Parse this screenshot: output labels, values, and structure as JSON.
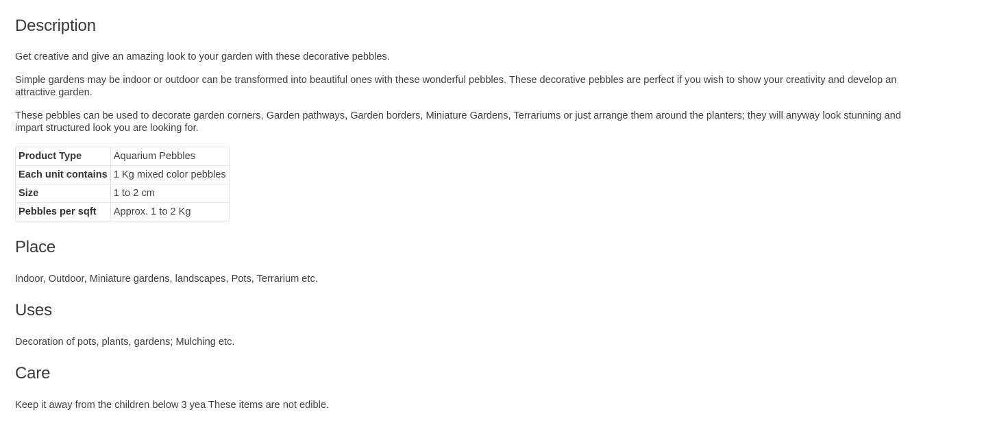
{
  "description": {
    "heading": "Description",
    "paragraphs": [
      "Get creative and give an amazing look to your garden with these decorative pebbles.",
      "Simple gardens may be indoor or outdoor can be transformed into beautiful ones with these wonderful pebbles. These decorative pebbles are perfect if you wish to show your creativity and develop an attractive garden.",
      "These pebbles can be used to decorate garden corners, Garden pathways, Garden borders, Miniature Gardens, Terrariums or just arrange them around the planters; they will anyway look stunning and impart structured look you are looking for."
    ]
  },
  "specs": [
    {
      "key": "Product Type",
      "value": "Aquarium Pebbles"
    },
    {
      "key": "Each unit contains",
      "value": "1 Kg mixed color pebbles"
    },
    {
      "key": "Size",
      "value": "1 to 2 cm"
    },
    {
      "key": "Pebbles per sqft",
      "value": "Approx. 1 to 2 Kg"
    }
  ],
  "place": {
    "heading": "Place",
    "text": "Indoor, Outdoor, Miniature gardens, landscapes, Pots, Terrarium etc."
  },
  "uses": {
    "heading": "Uses",
    "text": "Decoration of pots, plants, gardens; Mulching etc."
  },
  "care": {
    "heading": "Care",
    "text": "Keep it away from the children below 3 yea These items are not edible."
  }
}
